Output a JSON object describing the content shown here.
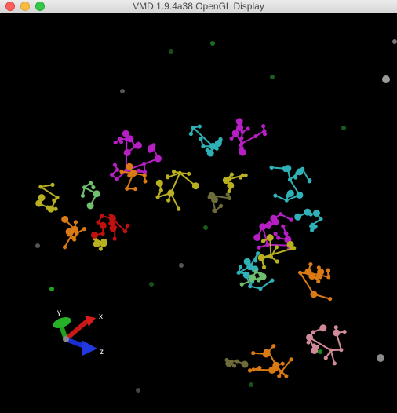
{
  "window": {
    "title": "VMD 1.9.4a38 OpenGL Display"
  },
  "axes": {
    "x_label": "x",
    "y_label": "y",
    "z_label": "z"
  },
  "colors": {
    "background": "#000000",
    "magenta": "#b51fc4",
    "cyan": "#2fb1b8",
    "yellow": "#b8b020",
    "orange": "#d97a14",
    "red": "#c01010",
    "green": "#6fbf6f",
    "pink": "#d08a98",
    "olive": "#6d6b3a",
    "grey": "#9a9a9a",
    "axis_x": "#c81818",
    "axis_y": "#1fa01f",
    "axis_z": "#1a2fd0"
  }
}
